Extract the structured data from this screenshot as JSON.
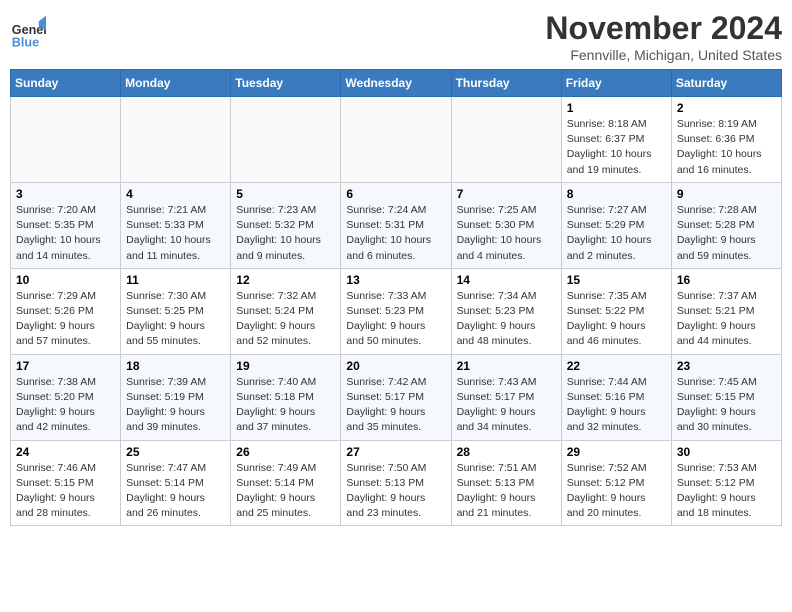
{
  "logo": {
    "line1": "General",
    "line2": "Blue"
  },
  "title": "November 2024",
  "location": "Fennville, Michigan, United States",
  "days_of_week": [
    "Sunday",
    "Monday",
    "Tuesday",
    "Wednesday",
    "Thursday",
    "Friday",
    "Saturday"
  ],
  "weeks": [
    [
      {
        "day": "",
        "info": ""
      },
      {
        "day": "",
        "info": ""
      },
      {
        "day": "",
        "info": ""
      },
      {
        "day": "",
        "info": ""
      },
      {
        "day": "",
        "info": ""
      },
      {
        "day": "1",
        "info": "Sunrise: 8:18 AM\nSunset: 6:37 PM\nDaylight: 10 hours and 19 minutes."
      },
      {
        "day": "2",
        "info": "Sunrise: 8:19 AM\nSunset: 6:36 PM\nDaylight: 10 hours and 16 minutes."
      }
    ],
    [
      {
        "day": "3",
        "info": "Sunrise: 7:20 AM\nSunset: 5:35 PM\nDaylight: 10 hours and 14 minutes."
      },
      {
        "day": "4",
        "info": "Sunrise: 7:21 AM\nSunset: 5:33 PM\nDaylight: 10 hours and 11 minutes."
      },
      {
        "day": "5",
        "info": "Sunrise: 7:23 AM\nSunset: 5:32 PM\nDaylight: 10 hours and 9 minutes."
      },
      {
        "day": "6",
        "info": "Sunrise: 7:24 AM\nSunset: 5:31 PM\nDaylight: 10 hours and 6 minutes."
      },
      {
        "day": "7",
        "info": "Sunrise: 7:25 AM\nSunset: 5:30 PM\nDaylight: 10 hours and 4 minutes."
      },
      {
        "day": "8",
        "info": "Sunrise: 7:27 AM\nSunset: 5:29 PM\nDaylight: 10 hours and 2 minutes."
      },
      {
        "day": "9",
        "info": "Sunrise: 7:28 AM\nSunset: 5:28 PM\nDaylight: 9 hours and 59 minutes."
      }
    ],
    [
      {
        "day": "10",
        "info": "Sunrise: 7:29 AM\nSunset: 5:26 PM\nDaylight: 9 hours and 57 minutes."
      },
      {
        "day": "11",
        "info": "Sunrise: 7:30 AM\nSunset: 5:25 PM\nDaylight: 9 hours and 55 minutes."
      },
      {
        "day": "12",
        "info": "Sunrise: 7:32 AM\nSunset: 5:24 PM\nDaylight: 9 hours and 52 minutes."
      },
      {
        "day": "13",
        "info": "Sunrise: 7:33 AM\nSunset: 5:23 PM\nDaylight: 9 hours and 50 minutes."
      },
      {
        "day": "14",
        "info": "Sunrise: 7:34 AM\nSunset: 5:23 PM\nDaylight: 9 hours and 48 minutes."
      },
      {
        "day": "15",
        "info": "Sunrise: 7:35 AM\nSunset: 5:22 PM\nDaylight: 9 hours and 46 minutes."
      },
      {
        "day": "16",
        "info": "Sunrise: 7:37 AM\nSunset: 5:21 PM\nDaylight: 9 hours and 44 minutes."
      }
    ],
    [
      {
        "day": "17",
        "info": "Sunrise: 7:38 AM\nSunset: 5:20 PM\nDaylight: 9 hours and 42 minutes."
      },
      {
        "day": "18",
        "info": "Sunrise: 7:39 AM\nSunset: 5:19 PM\nDaylight: 9 hours and 39 minutes."
      },
      {
        "day": "19",
        "info": "Sunrise: 7:40 AM\nSunset: 5:18 PM\nDaylight: 9 hours and 37 minutes."
      },
      {
        "day": "20",
        "info": "Sunrise: 7:42 AM\nSunset: 5:17 PM\nDaylight: 9 hours and 35 minutes."
      },
      {
        "day": "21",
        "info": "Sunrise: 7:43 AM\nSunset: 5:17 PM\nDaylight: 9 hours and 34 minutes."
      },
      {
        "day": "22",
        "info": "Sunrise: 7:44 AM\nSunset: 5:16 PM\nDaylight: 9 hours and 32 minutes."
      },
      {
        "day": "23",
        "info": "Sunrise: 7:45 AM\nSunset: 5:15 PM\nDaylight: 9 hours and 30 minutes."
      }
    ],
    [
      {
        "day": "24",
        "info": "Sunrise: 7:46 AM\nSunset: 5:15 PM\nDaylight: 9 hours and 28 minutes."
      },
      {
        "day": "25",
        "info": "Sunrise: 7:47 AM\nSunset: 5:14 PM\nDaylight: 9 hours and 26 minutes."
      },
      {
        "day": "26",
        "info": "Sunrise: 7:49 AM\nSunset: 5:14 PM\nDaylight: 9 hours and 25 minutes."
      },
      {
        "day": "27",
        "info": "Sunrise: 7:50 AM\nSunset: 5:13 PM\nDaylight: 9 hours and 23 minutes."
      },
      {
        "day": "28",
        "info": "Sunrise: 7:51 AM\nSunset: 5:13 PM\nDaylight: 9 hours and 21 minutes."
      },
      {
        "day": "29",
        "info": "Sunrise: 7:52 AM\nSunset: 5:12 PM\nDaylight: 9 hours and 20 minutes."
      },
      {
        "day": "30",
        "info": "Sunrise: 7:53 AM\nSunset: 5:12 PM\nDaylight: 9 hours and 18 minutes."
      }
    ]
  ]
}
